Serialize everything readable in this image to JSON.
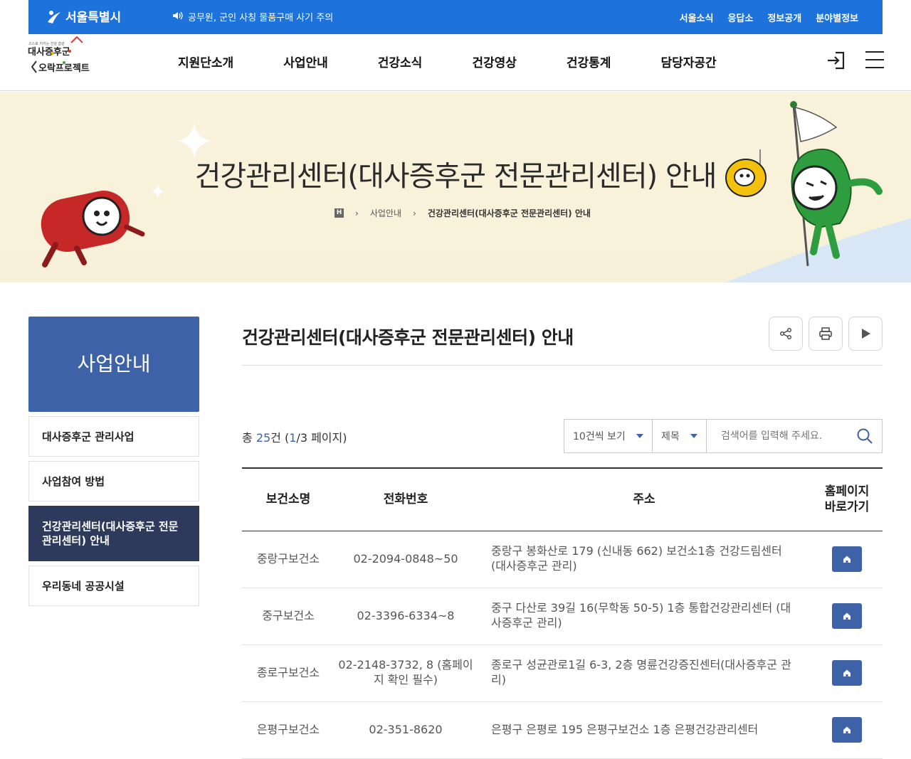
{
  "topbar": {
    "seoul_logo": "서울특별시",
    "notice": "공무원, 군인 사칭 물품구매 사기 주의",
    "links": [
      "서울소식",
      "응답소",
      "정보공개",
      "분야별정보"
    ]
  },
  "logo": {
    "small": "스스로 지키는 건강 습관",
    "line1": "대사증후군",
    "line2": "오락프로젝트"
  },
  "gnb": [
    "지원단소개",
    "사업안내",
    "건강소식",
    "건강영상",
    "건강통계",
    "담당자공간"
  ],
  "banner": {
    "title": "건강관리센터(대사증후군 전문관리센터) 안내",
    "home_icon": "H",
    "breadcrumb": [
      "사업안내",
      "건강관리센터(대사증후군 전문관리센터) 안내"
    ]
  },
  "lnb": {
    "title": "사업안내",
    "items": [
      "대사증후군 관리사업",
      "사업참여 방법",
      "건강관리센터(대사증후군 전문관리센터) 안내",
      "우리동네 공공시설"
    ],
    "active_index": 2
  },
  "content": {
    "title": "건강관리센터(대사증후군 전문관리센터) 안내",
    "count_prefix": "총 ",
    "count_total": "25",
    "count_mid": "건 (",
    "count_page": "1",
    "count_suffix": "/3 페이지)",
    "per_page": "10건씩 보기",
    "field": "제목",
    "search_placeholder": "검색어를 입력해 주세요."
  },
  "table": {
    "headers": [
      "보건소명",
      "전화번호",
      "주소",
      "홈페이지\n바로가기"
    ],
    "rows": [
      {
        "name": "중랑구보건소",
        "phone": "02-2094-0848~50",
        "address": "중랑구 봉화산로 179 (신내동 662) 보건소1층 건강드림센터 (대사증후군 관리)"
      },
      {
        "name": "중구보건소",
        "phone": "02-3396-6334~8",
        "address": "중구 다산로 39길 16(무학동 50-5) 1층 통합건강관리센터 (대사증후군 관리)"
      },
      {
        "name": "종로구보건소",
        "phone": "02-2148-3732, 8 (홈페이지 확인 필수)",
        "address": "종로구 성균관로1길 6-3, 2층 명륜건강증진센터(대사증후군 관리)"
      },
      {
        "name": "은평구보건소",
        "phone": "02-351-8620",
        "address": "은평구 은평로 195 은평구보건소 1층 은평건강관리센터"
      }
    ]
  },
  "colors": {
    "topbar": "#1d72dc",
    "accent": "#3e62a8",
    "active_nav": "#2d3a5c",
    "banner_bg": "#f9f3dc"
  }
}
